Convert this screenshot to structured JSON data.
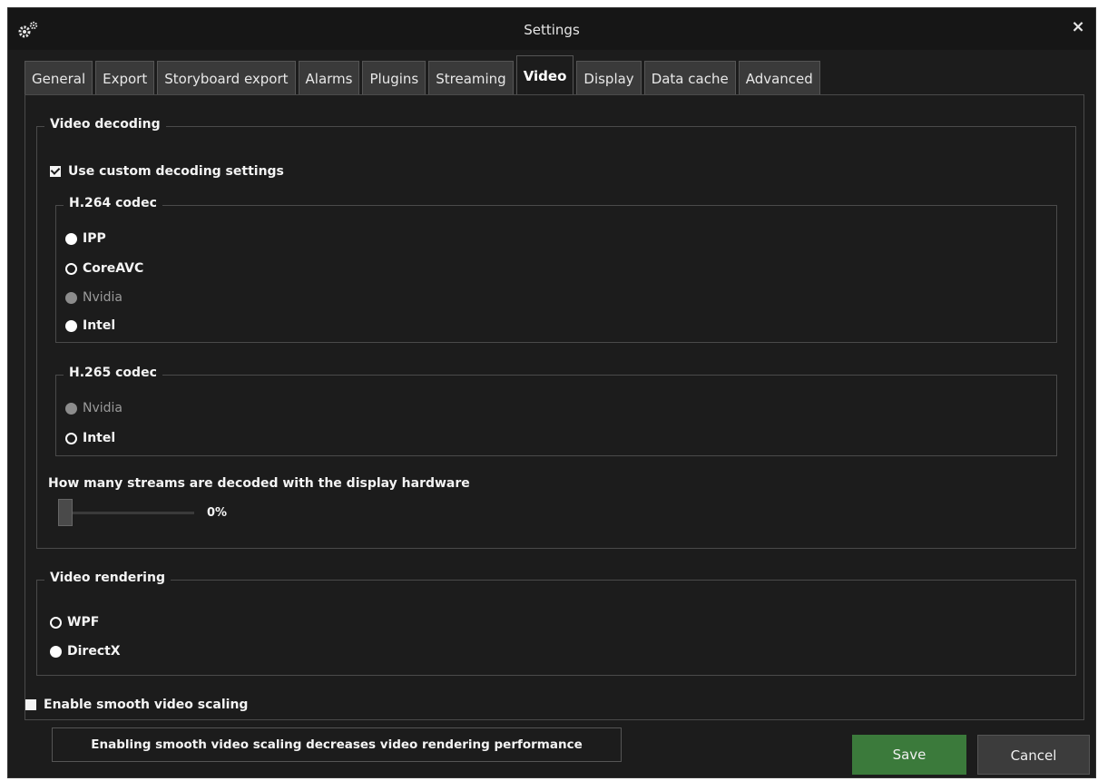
{
  "window": {
    "title": "Settings",
    "close_glyph": "×",
    "title_icon": "gears-icon"
  },
  "tabs": [
    {
      "label": "General",
      "active": false
    },
    {
      "label": "Export",
      "active": false
    },
    {
      "label": "Storyboard export",
      "active": false
    },
    {
      "label": "Alarms",
      "active": false
    },
    {
      "label": "Plugins",
      "active": false
    },
    {
      "label": "Streaming",
      "active": false
    },
    {
      "label": "Video",
      "active": true
    },
    {
      "label": "Display",
      "active": false
    },
    {
      "label": "Data cache",
      "active": false
    },
    {
      "label": "Advanced",
      "active": false
    }
  ],
  "video_decoding": {
    "legend": "Video decoding",
    "custom_settings": {
      "label": "Use custom decoding settings",
      "checked": true
    },
    "h264": {
      "legend": "H.264 codec",
      "options": [
        {
          "label": "IPP",
          "state": "filled"
        },
        {
          "label": "CoreAVC",
          "state": "empty"
        },
        {
          "label": "Nvidia",
          "state": "disabled"
        },
        {
          "label": "Intel",
          "state": "filled"
        }
      ]
    },
    "h265": {
      "legend": "H.265 codec",
      "options": [
        {
          "label": "Nvidia",
          "state": "disabled"
        },
        {
          "label": "Intel",
          "state": "empty"
        }
      ]
    },
    "streams_label": "How many streams are decoded with the display hardware",
    "slider": {
      "value_text": "0%",
      "fraction": 0
    }
  },
  "video_rendering": {
    "legend": "Video rendering",
    "options": [
      {
        "label": "WPF",
        "state": "empty"
      },
      {
        "label": "DirectX",
        "state": "filled"
      }
    ]
  },
  "smooth_scaling": {
    "label": "Enable smooth video scaling",
    "checked": false
  },
  "info_text": "Enabling smooth video scaling decreases video rendering performance",
  "buttons": {
    "save": "Save",
    "cancel": "Cancel"
  },
  "colors": {
    "save_button": "#3b7a3b",
    "window_bg": "#1c1c1c"
  }
}
